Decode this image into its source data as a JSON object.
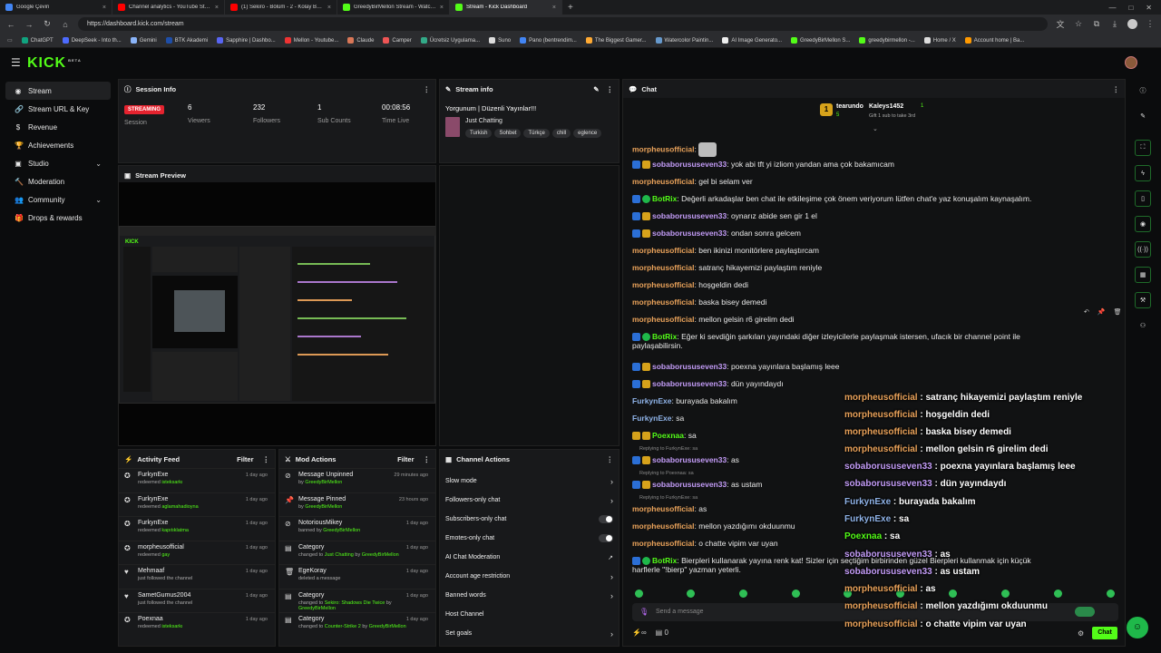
{
  "browser": {
    "tabs": [
      {
        "label": "Google Çeviri",
        "color": "#4285f4"
      },
      {
        "label": "Channel analytics - YouTube Studio",
        "color": "#ff0000"
      },
      {
        "label": "(1) Sekiro - Bölüm - 2 - Kolay Boss",
        "color": "#ff0000"
      },
      {
        "label": "GreedyBirMellon Stream - Watch Live",
        "color": "#53fc18"
      },
      {
        "label": "Stream - Kick Dashboard",
        "color": "#53fc18"
      }
    ],
    "url": "https://dashboard.kick.com/stream",
    "bookmarks": [
      "ChatGPT",
      "DeepSeek - Into th...",
      "Gemini",
      "BTK Akademi",
      "Sapphire | Dashbo...",
      "Mellon - Youtube...",
      "Claude",
      "Camper",
      "Ücretsiz Uygulama...",
      "Suno",
      "Pano (bentrendim...",
      "The Biggest Gamer...",
      "Watercolor Paintin...",
      "AI Image Generato...",
      "GreedyBirMellon S...",
      "greedybirmellon -...",
      "Home / X",
      "Account home | Ba..."
    ]
  },
  "kick": {
    "logo": "KICK",
    "beta": "BETA",
    "accent": "#53fc18"
  },
  "sidebar": {
    "items": [
      {
        "label": "Stream",
        "icon": "broadcast-icon"
      },
      {
        "label": "Stream URL & Key",
        "icon": "link-icon"
      },
      {
        "label": "Revenue",
        "icon": "money-icon"
      },
      {
        "label": "Achievements",
        "icon": "trophy-icon"
      },
      {
        "label": "Studio",
        "icon": "studio-icon"
      },
      {
        "label": "Moderation",
        "icon": "hammer-icon"
      },
      {
        "label": "Community",
        "icon": "community-icon"
      },
      {
        "label": "Drops & rewards",
        "icon": "gift-icon"
      }
    ]
  },
  "session": {
    "title": "Session Info",
    "status": "STREAMING",
    "status_label": "Session",
    "stats": [
      {
        "value": "6",
        "label": "Viewers"
      },
      {
        "value": "232",
        "label": "Followers"
      },
      {
        "value": "1",
        "label": "Sub Counts"
      },
      {
        "value": "00:08:56",
        "label": "Time Live"
      }
    ]
  },
  "stream_info": {
    "title": "Stream info",
    "stream_title": "Yorgunum | Düzenli Yayınlar!!!",
    "category": "Just Chatting",
    "tags": [
      "Turkish",
      "Sohbet",
      "Türkçe",
      "chill",
      "eglence"
    ]
  },
  "preview": {
    "title": "Stream Preview"
  },
  "activity": {
    "title": "Activity Feed",
    "filter": "Filter",
    "items": [
      {
        "name": "FurkynExe",
        "pre": "redeemed",
        "hl": "isteksarkı",
        "time": "1 day ago",
        "icon": "reward-icon"
      },
      {
        "name": "FurkynExe",
        "pre": "redeemed",
        "hl": "aglamahadioyna",
        "time": "1 day ago",
        "icon": "reward-icon"
      },
      {
        "name": "FurkynExe",
        "pre": "redeemed",
        "hl": "kapıtıklatma",
        "time": "1 day ago",
        "icon": "reward-icon"
      },
      {
        "name": "morpheusofficial",
        "pre": "redeemed",
        "hl": "gay",
        "time": "1 day ago",
        "icon": "reward-icon"
      },
      {
        "name": "Mehmaaf",
        "pre": "just followed the channel",
        "hl": "",
        "time": "1 day ago",
        "icon": "heart-icon"
      },
      {
        "name": "SametGumus2004",
        "pre": "just followed the channel",
        "hl": "",
        "time": "1 day ago",
        "icon": "heart-icon"
      },
      {
        "name": "Poexnaa",
        "pre": "redeemed",
        "hl": "isteksarkı",
        "time": "1 day ago",
        "icon": "reward-icon"
      }
    ]
  },
  "mod": {
    "title": "Mod Actions",
    "filter": "Filter",
    "items": [
      {
        "name": "Message Unpinned",
        "pre": "by",
        "hl": "GreedyBirMellon",
        "time": "29 minutes ago",
        "icon": "unpin-icon"
      },
      {
        "name": "Message Pinned",
        "pre": "by",
        "hl": "GreedyBirMellon",
        "time": "23 hours ago",
        "icon": "pin-icon"
      },
      {
        "name": "NotoriousMikey",
        "pre": "banned by",
        "hl": "GreedyBirMellon",
        "time": "1 day ago",
        "icon": "ban-icon"
      },
      {
        "name": "Category",
        "pre": "changed to",
        "hl": "Just Chatting",
        "pre2": "by",
        "hl2": "GreedyBirMellon",
        "time": "1 day ago",
        "icon": "category-icon"
      },
      {
        "name": "EgeKoray",
        "pre": "deleted a message",
        "hl": "",
        "time": "1 day ago",
        "icon": "trash-icon"
      },
      {
        "name": "Category",
        "pre": "changed to",
        "hl": "Sekiro: Shadows Die Twice",
        "pre2": "by",
        "hl2": "GreedyBirMellon",
        "time": "1 day ago",
        "icon": "category-icon"
      },
      {
        "name": "Category",
        "pre": "changed to",
        "hl": "Counter-Strike 2",
        "pre2": "by",
        "hl2": "GreedyBirMellon",
        "time": "1 day ago",
        "icon": "category-icon"
      }
    ]
  },
  "channel_actions": {
    "title": "Channel Actions",
    "items": [
      {
        "label": "Slow mode",
        "kind": "arrow"
      },
      {
        "label": "Followers-only chat",
        "kind": "arrow"
      },
      {
        "label": "Subscribers-only chat",
        "kind": "toggle"
      },
      {
        "label": "Emotes-only chat",
        "kind": "toggle"
      },
      {
        "label": "AI Chat Moderation",
        "kind": "ext"
      },
      {
        "label": "Account age restriction",
        "kind": "arrow"
      },
      {
        "label": "Banned words",
        "kind": "arrow"
      },
      {
        "label": "Host Channel",
        "kind": "none"
      },
      {
        "label": "Set goals",
        "kind": "arrow"
      }
    ]
  },
  "chat": {
    "title": "Chat",
    "gifter1_name": "tearundo",
    "gifter1_count": "5",
    "gifter2_name": "Kaleys1452",
    "gifter2_count": "1",
    "gift_note": "Gift 1 sub to take 3rd",
    "input_placeholder": "Send a message",
    "send_label": "Chat",
    "count": "0",
    "messages": [
      {
        "user": "morpheusofficial",
        "color": "#e9a25a",
        "text": "",
        "badges": [],
        "emote": true
      },
      {
        "user": "sobaborususeven33",
        "color": "#c39cf7",
        "text": "yok abi tft yi izliom yandan ama çok bakamıcam",
        "badges": [
          "b-blue",
          "b-gold"
        ]
      },
      {
        "user": "morpheusofficial",
        "color": "#e9a25a",
        "text": "gel bi selam ver",
        "badges": []
      },
      {
        "user": "BotRix",
        "color": "#53fc18",
        "text": "Değerli arkadaşlar ben chat ile etkileşime çok önem veriyorum lütfen chat'e yaz konuşalım kaynaşalım.",
        "badges": [
          "b-blue",
          "b-green"
        ]
      },
      {
        "user": "sobaborususeven33",
        "color": "#c39cf7",
        "text": "oynarız abide sen gir 1 el",
        "badges": [
          "b-blue",
          "b-gold"
        ]
      },
      {
        "user": "sobaborususeven33",
        "color": "#c39cf7",
        "text": "ondan sonra gelcem",
        "badges": [
          "b-blue",
          "b-gold"
        ]
      },
      {
        "user": "morpheusofficial",
        "color": "#e9a25a",
        "text": "ben ikinizi monitörlere paylaştırcam",
        "badges": []
      },
      {
        "user": "morpheusofficial",
        "color": "#e9a25a",
        "text": "satranç hikayemizi paylaştım reniyle",
        "badges": []
      },
      {
        "user": "morpheusofficial",
        "color": "#e9a25a",
        "text": "hoşgeldin dedi",
        "badges": []
      },
      {
        "user": "morpheusofficial",
        "color": "#e9a25a",
        "text": "baska bisey demedi",
        "badges": []
      },
      {
        "user": "morpheusofficial",
        "color": "#e9a25a",
        "text": "mellon gelsin r6 girelim dedi",
        "badges": []
      },
      {
        "user": "BotRix",
        "color": "#53fc18",
        "text": "Eğer ki sevdiğin şarkıları yayındaki diğer izleyicilerle paylaşmak istersen, ufacık bir channel point ile",
        "text2": "paylaşabilirsin.",
        "badges": [
          "b-blue",
          "b-green"
        ]
      },
      {
        "user": "sobaborususeven33",
        "color": "#c39cf7",
        "text": "poexna yayınlara başlamış leee",
        "badges": [
          "b-blue",
          "b-gold"
        ]
      },
      {
        "user": "sobaborususeven33",
        "color": "#c39cf7",
        "text": "dün yayındaydı",
        "badges": [
          "b-blue",
          "b-gold"
        ]
      },
      {
        "user": "FurkynExe",
        "color": "#8fb3e8",
        "text": "burayada bakalım",
        "badges": []
      },
      {
        "user": "FurkynExe",
        "color": "#8fb3e8",
        "text": "sa",
        "badges": []
      },
      {
        "user": "Poexnaa",
        "color": "#53fc18",
        "text": "sa",
        "badges": [
          "b-gold",
          "b-gold"
        ]
      },
      {
        "user": "sobaborususeven33",
        "color": "#c39cf7",
        "text": "as",
        "badges": [
          "b-blue",
          "b-gold"
        ],
        "reply": "Replying to FurkynExe: sa"
      },
      {
        "user": "sobaborususeven33",
        "color": "#c39cf7",
        "text": "as ustam",
        "badges": [
          "b-blue",
          "b-gold"
        ],
        "reply": "Replying to Poexnaa: sa"
      },
      {
        "user": "morpheusofficial",
        "color": "#e9a25a",
        "text": "as",
        "badges": [],
        "reply": "Replying to FurkynExe: sa"
      },
      {
        "user": "morpheusofficial",
        "color": "#e9a25a",
        "text": "mellon yazdığımı okduunmu",
        "badges": []
      },
      {
        "user": "morpheusofficial",
        "color": "#e9a25a",
        "text": "o chatte vipim var uyan",
        "badges": []
      },
      {
        "user": "BotRix",
        "color": "#53fc18",
        "text": "Bierpleri kullanarak yayına renk kat! Sizler için seçtiğim birbirinden güzel Bierpleri kullanmak için küçük",
        "text2": "harflerle \"!bierp\" yazman yeterli.",
        "badges": [
          "b-blue",
          "b-green"
        ]
      }
    ]
  },
  "overlay": {
    "lines": [
      {
        "user": "morpheusofficial",
        "color": "#e9a25a",
        "text": "satranç hikayemizi paylaştım reniyle"
      },
      {
        "user": "morpheusofficial",
        "color": "#e9a25a",
        "text": "hoşgeldin dedi"
      },
      {
        "user": "morpheusofficial",
        "color": "#e9a25a",
        "text": "baska bisey demedi"
      },
      {
        "user": "morpheusofficial",
        "color": "#e9a25a",
        "text": "mellon gelsin r6 girelim dedi"
      },
      {
        "user": "sobaborususeven33",
        "color": "#c39cf7",
        "text": "poexna yayınlara başlamış leee"
      },
      {
        "user": "sobaborususeven33",
        "color": "#c39cf7",
        "text": "dün yayındaydı"
      },
      {
        "user": "FurkynExe",
        "color": "#8fb3e8",
        "text": "burayada bakalım"
      },
      {
        "user": "FurkynExe",
        "color": "#8fb3e8",
        "text": "sa"
      },
      {
        "user": "Poexnaa",
        "color": "#53fc18",
        "text": "sa"
      },
      {
        "user": "sobaborususeven33",
        "color": "#c39cf7",
        "text": "as"
      },
      {
        "user": "sobaborususeven33",
        "color": "#c39cf7",
        "text": "as ustam"
      },
      {
        "user": "morpheusofficial",
        "color": "#e9a25a",
        "text": "as"
      },
      {
        "user": "morpheusofficial",
        "color": "#e9a25a",
        "text": "mellon yazdığımı okduunmu"
      },
      {
        "user": "morpheusofficial",
        "color": "#e9a25a",
        "text": "o chatte vipim var uyan"
      }
    ]
  }
}
